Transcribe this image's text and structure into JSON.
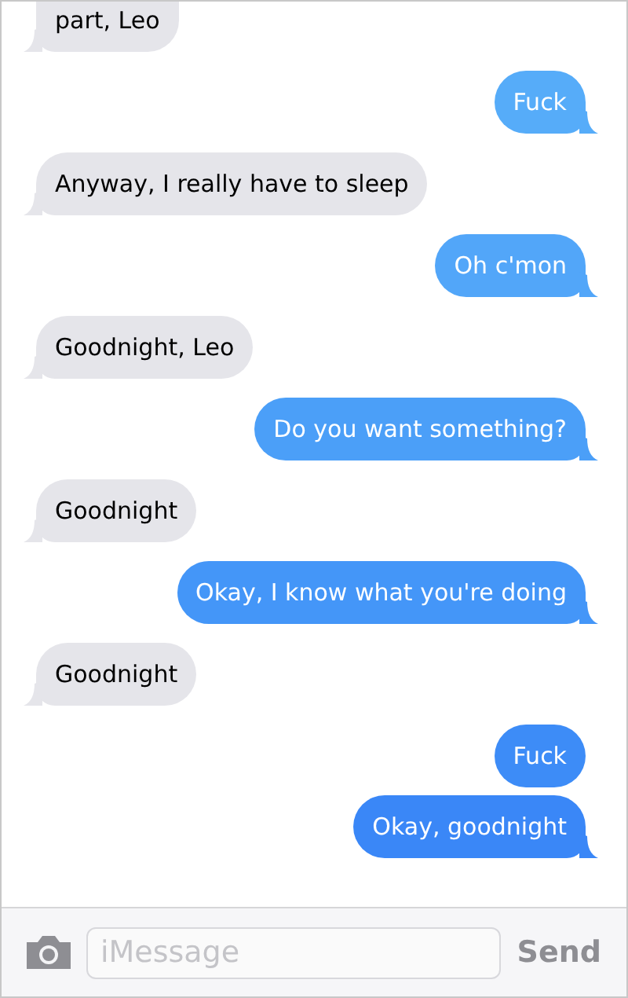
{
  "messages": [
    {
      "kind": "received",
      "text": "part, Leo",
      "tail": true
    },
    {
      "kind": "sent",
      "text": "Fuck",
      "tail": true,
      "color": "#56acf9"
    },
    {
      "kind": "received",
      "text": "Anyway, I really have to sleep",
      "tail": true
    },
    {
      "kind": "sent",
      "text": "Oh c'mon",
      "tail": true,
      "color": "#52a6f9"
    },
    {
      "kind": "received",
      "text": "Goodnight, Leo",
      "tail": true
    },
    {
      "kind": "sent",
      "text": "Do you want something?",
      "tail": true,
      "color": "#4b9ff8"
    },
    {
      "kind": "received",
      "text": "Goodnight",
      "tail": true
    },
    {
      "kind": "sent",
      "text": "Okay, I know what you're doing",
      "tail": true,
      "color": "#4496f8"
    },
    {
      "kind": "received",
      "text": "Goodnight",
      "tail": true
    },
    {
      "kind": "sent",
      "text": "Fuck",
      "tail": false,
      "color": "#3d8cf7"
    },
    {
      "kind": "sent",
      "text": "Okay, goodnight",
      "tail": true,
      "color": "#3a87f7"
    }
  ],
  "composer": {
    "placeholder": "iMessage",
    "send": "Send"
  }
}
